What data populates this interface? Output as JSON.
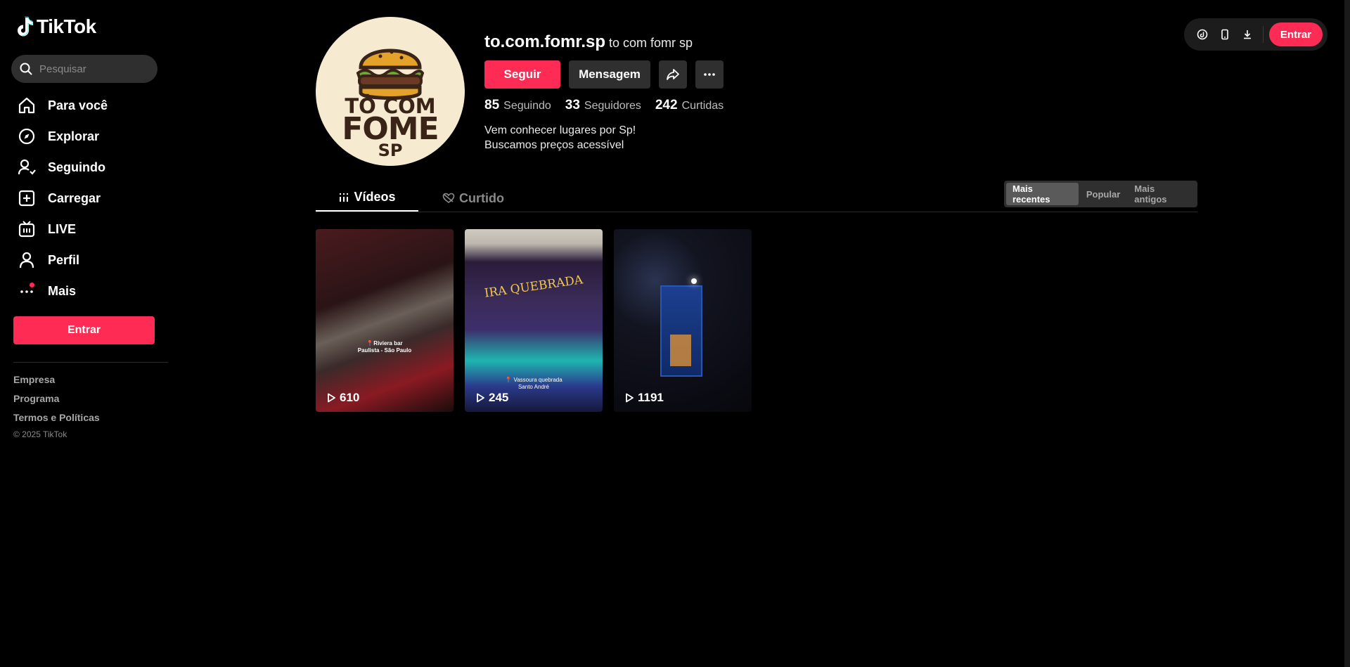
{
  "app": {
    "name": "TikTok"
  },
  "search": {
    "placeholder": "Pesquisar"
  },
  "sidebar": {
    "items": [
      {
        "label": "Para você",
        "icon": "home-icon"
      },
      {
        "label": "Explorar",
        "icon": "compass-icon"
      },
      {
        "label": "Seguindo",
        "icon": "following-icon"
      },
      {
        "label": "Carregar",
        "icon": "upload-icon"
      },
      {
        "label": "LIVE",
        "icon": "live-icon"
      },
      {
        "label": "Perfil",
        "icon": "profile-icon"
      },
      {
        "label": "Mais",
        "icon": "more-icon"
      }
    ],
    "login_label": "Entrar",
    "footer_links": [
      "Empresa",
      "Programa",
      "Termos e Políticas"
    ],
    "copyright": "© 2025 TikTok"
  },
  "topbar": {
    "login_label": "Entrar"
  },
  "profile": {
    "avatar_text": [
      "TÔ COM",
      "FOME",
      "SP"
    ],
    "username": "to.com.fomr.sp",
    "nickname": "to com fomr sp",
    "follow_label": "Seguir",
    "message_label": "Mensagem",
    "stats": [
      {
        "value": "85",
        "label": "Seguindo"
      },
      {
        "value": "33",
        "label": "Seguidores"
      },
      {
        "value": "242",
        "label": "Curtidas"
      }
    ],
    "bio": [
      "Vem conhecer lugares por Sp!",
      "Buscamos preços acessível"
    ]
  },
  "tabs": [
    {
      "label": "Vídeos",
      "active": true
    },
    {
      "label": "Curtido",
      "active": false
    }
  ],
  "sort": {
    "options": [
      "Mais recentes",
      "Popular",
      "Mais antigos"
    ],
    "selected": "Mais recentes"
  },
  "videos": [
    {
      "views": "610",
      "caption": [
        "📍Riviera bar",
        "Paulista - São Paulo"
      ]
    },
    {
      "views": "245",
      "caption": [
        "📍 Vassoura quebrada",
        "Santo André"
      ],
      "sign": "IRA QUEBRADA"
    },
    {
      "views": "1191"
    }
  ],
  "colors": {
    "accent": "#fe2c55",
    "background": "#000000",
    "surface": "#2f2f2f"
  }
}
